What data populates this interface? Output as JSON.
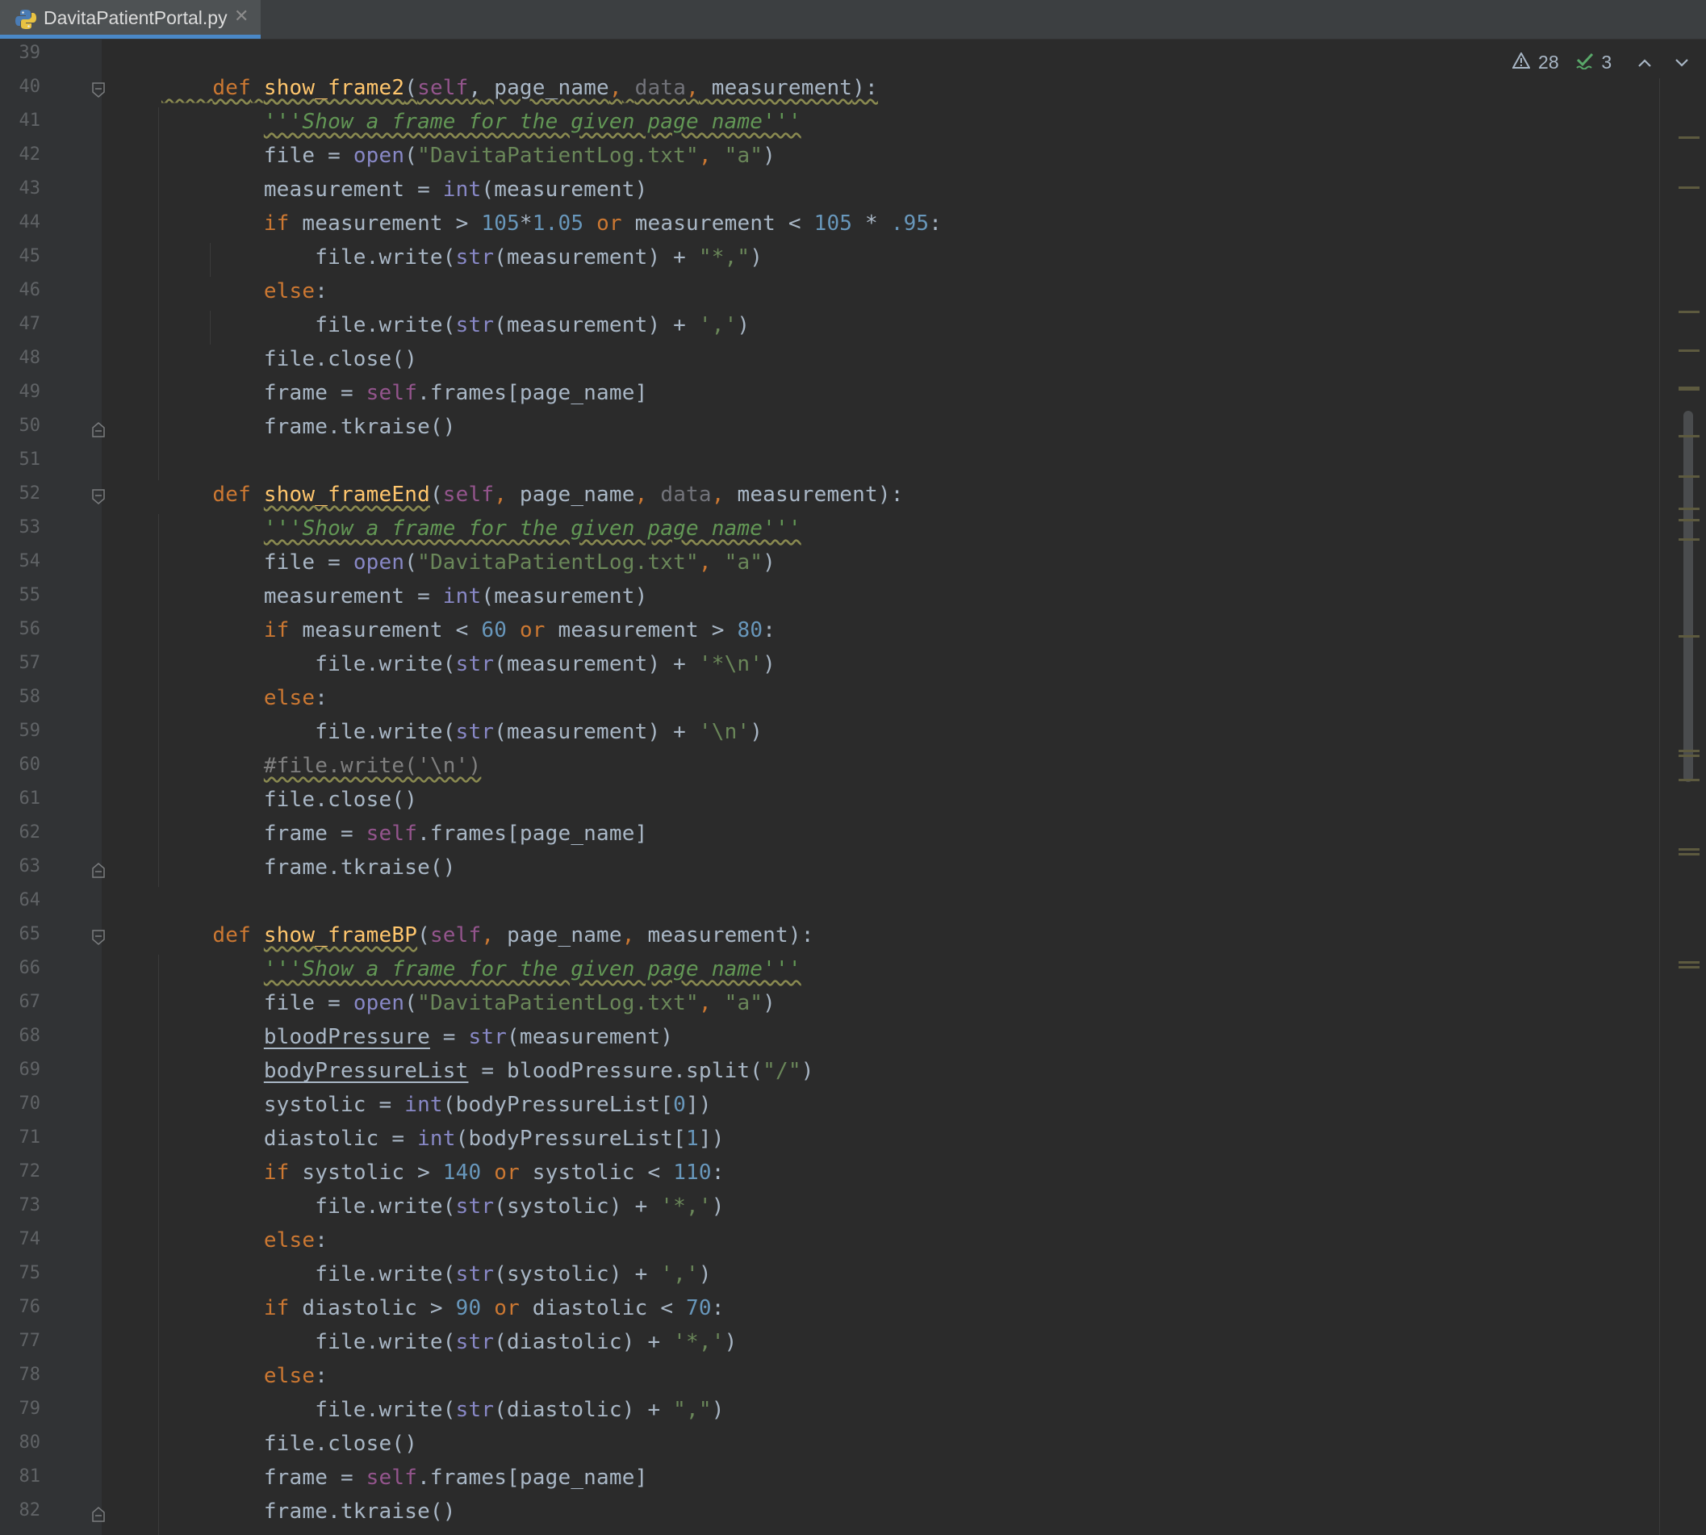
{
  "tab": {
    "filename": "DavitaPatientPortal.py",
    "icon": "python-file-icon",
    "close_icon": "close-icon"
  },
  "inspections": {
    "warnings": "28",
    "typos": "3"
  },
  "colors": {
    "background": "#2b2b2b",
    "keyword": "#cc7832",
    "function": "#ffc66d",
    "string": "#6a8759",
    "number": "#6897bb",
    "self": "#94558d",
    "builtin": "#8888c6",
    "docstring": "#629755"
  },
  "lines": [
    {
      "n": "39",
      "t": []
    },
    {
      "n": "40",
      "t": [
        [
          "    ",
          ""
        ],
        [
          "def",
          "kw"
        ],
        [
          " ",
          ""
        ],
        [
          "show_frame2",
          "fn"
        ],
        [
          "(",
          ""
        ],
        [
          "self",
          "sf"
        ],
        [
          ",",
          ""
        ],
        [
          " page_name",
          ""
        ],
        [
          ",",
          "kw"
        ],
        [
          " ",
          ""
        ],
        [
          "data",
          "gr"
        ],
        [
          ",",
          "kw"
        ],
        [
          " measurement",
          ""
        ],
        [
          "):",
          ""
        ]
      ],
      "wave": true,
      "fold": "open"
    },
    {
      "n": "41",
      "t": [
        [
          "        ",
          ""
        ],
        [
          "'''Show a frame for the given page name'''",
          "doc"
        ]
      ]
    },
    {
      "n": "42",
      "t": [
        [
          "        file = ",
          ""
        ],
        [
          "open",
          "bi"
        ],
        [
          "(",
          ""
        ],
        [
          "\"DavitaPatientLog.txt\"",
          "st"
        ],
        [
          ", ",
          "kw"
        ],
        [
          "\"a\"",
          "st"
        ],
        [
          ")",
          ""
        ]
      ]
    },
    {
      "n": "43",
      "t": [
        [
          "        measurement = ",
          ""
        ],
        [
          "int",
          "bi"
        ],
        [
          "(measurement)",
          ""
        ]
      ]
    },
    {
      "n": "44",
      "t": [
        [
          "        ",
          ""
        ],
        [
          "if",
          "kw"
        ],
        [
          " measurement > ",
          ""
        ],
        [
          "105",
          "nu"
        ],
        [
          "*",
          ""
        ],
        [
          "1.05",
          "nu"
        ],
        [
          " ",
          ""
        ],
        [
          "or",
          "kw"
        ],
        [
          " measurement < ",
          ""
        ],
        [
          "105",
          "nu"
        ],
        [
          " * ",
          ""
        ],
        [
          ".95",
          "nu"
        ],
        [
          ":",
          ""
        ]
      ]
    },
    {
      "n": "45",
      "t": [
        [
          "            file.write(",
          ""
        ],
        [
          "str",
          "bi"
        ],
        [
          "(measurement) + ",
          ""
        ],
        [
          "\"*,\"",
          "st"
        ],
        [
          ")",
          ""
        ]
      ]
    },
    {
      "n": "46",
      "t": [
        [
          "        ",
          ""
        ],
        [
          "else",
          "kw"
        ],
        [
          ":",
          ""
        ]
      ]
    },
    {
      "n": "47",
      "t": [
        [
          "            file.write(",
          ""
        ],
        [
          "str",
          "bi"
        ],
        [
          "(measurement) + ",
          ""
        ],
        [
          "','",
          "st"
        ],
        [
          ")",
          ""
        ]
      ]
    },
    {
      "n": "48",
      "t": [
        [
          "        file.close()",
          ""
        ]
      ]
    },
    {
      "n": "49",
      "t": [
        [
          "        frame = ",
          ""
        ],
        [
          "self",
          "sf"
        ],
        [
          ".frames[page_name]",
          ""
        ]
      ]
    },
    {
      "n": "50",
      "t": [
        [
          "        frame.tkraise()",
          ""
        ]
      ],
      "fold": "close"
    },
    {
      "n": "51",
      "t": []
    },
    {
      "n": "52",
      "t": [
        [
          "    ",
          ""
        ],
        [
          "def",
          "kw"
        ],
        [
          " ",
          ""
        ],
        [
          "show_frameEnd",
          "fn"
        ],
        [
          "(",
          ""
        ],
        [
          "self",
          "sf"
        ],
        [
          ",",
          "kw"
        ],
        [
          " page_name",
          ""
        ],
        [
          ",",
          "kw"
        ],
        [
          " ",
          ""
        ],
        [
          "data",
          "gr"
        ],
        [
          ",",
          "kw"
        ],
        [
          " measurement):",
          ""
        ]
      ],
      "fold": "open"
    },
    {
      "n": "53",
      "t": [
        [
          "        ",
          ""
        ],
        [
          "'''Show a frame for the given page name'''",
          "doc"
        ]
      ]
    },
    {
      "n": "54",
      "t": [
        [
          "        file = ",
          ""
        ],
        [
          "open",
          "bi"
        ],
        [
          "(",
          ""
        ],
        [
          "\"DavitaPatientLog.txt\"",
          "st"
        ],
        [
          ", ",
          "kw"
        ],
        [
          "\"a\"",
          "st"
        ],
        [
          ")",
          ""
        ]
      ]
    },
    {
      "n": "55",
      "t": [
        [
          "        measurement = ",
          ""
        ],
        [
          "int",
          "bi"
        ],
        [
          "(measurement)",
          ""
        ]
      ]
    },
    {
      "n": "56",
      "t": [
        [
          "        ",
          ""
        ],
        [
          "if",
          "kw"
        ],
        [
          " measurement < ",
          ""
        ],
        [
          "60",
          "nu"
        ],
        [
          " ",
          ""
        ],
        [
          "or",
          "kw"
        ],
        [
          " measurement > ",
          ""
        ],
        [
          "80",
          "nu"
        ],
        [
          ":",
          ""
        ]
      ]
    },
    {
      "n": "57",
      "t": [
        [
          "            file.write(",
          ""
        ],
        [
          "str",
          "bi"
        ],
        [
          "(measurement) + ",
          ""
        ],
        [
          "'*\\n'",
          "st"
        ],
        [
          ")",
          ""
        ]
      ]
    },
    {
      "n": "58",
      "t": [
        [
          "        ",
          ""
        ],
        [
          "else",
          "kw"
        ],
        [
          ":",
          ""
        ]
      ]
    },
    {
      "n": "59",
      "t": [
        [
          "            file.write(",
          ""
        ],
        [
          "str",
          "bi"
        ],
        [
          "(measurement) + ",
          ""
        ],
        [
          "'\\n'",
          "st"
        ],
        [
          ")",
          ""
        ]
      ]
    },
    {
      "n": "60",
      "t": [
        [
          "        ",
          ""
        ],
        [
          "#file.write('\\n')",
          "cm"
        ]
      ]
    },
    {
      "n": "61",
      "t": [
        [
          "        file.close()",
          ""
        ]
      ]
    },
    {
      "n": "62",
      "t": [
        [
          "        frame = ",
          ""
        ],
        [
          "self",
          "sf"
        ],
        [
          ".frames[page_name]",
          ""
        ]
      ]
    },
    {
      "n": "63",
      "t": [
        [
          "        frame.tkraise()",
          ""
        ]
      ],
      "fold": "close"
    },
    {
      "n": "64",
      "t": []
    },
    {
      "n": "65",
      "t": [
        [
          "    ",
          ""
        ],
        [
          "def",
          "kw"
        ],
        [
          " ",
          ""
        ],
        [
          "show_frameBP",
          "fn"
        ],
        [
          "(",
          ""
        ],
        [
          "self",
          "sf"
        ],
        [
          ",",
          "kw"
        ],
        [
          " page_name",
          ""
        ],
        [
          ",",
          "kw"
        ],
        [
          " measurement):",
          ""
        ]
      ],
      "fold": "open"
    },
    {
      "n": "66",
      "t": [
        [
          "        ",
          ""
        ],
        [
          "'''Show a frame for the given page name'''",
          "doc"
        ]
      ]
    },
    {
      "n": "67",
      "t": [
        [
          "        file = ",
          ""
        ],
        [
          "open",
          "bi"
        ],
        [
          "(",
          ""
        ],
        [
          "\"DavitaPatientLog.txt\"",
          "st"
        ],
        [
          ", ",
          "kw"
        ],
        [
          "\"a\"",
          "st"
        ],
        [
          ")",
          ""
        ]
      ]
    },
    {
      "n": "68",
      "t": [
        [
          "        ",
          ""
        ],
        [
          "bloodPressure",
          "ul"
        ],
        [
          " = ",
          ""
        ],
        [
          "str",
          "bi"
        ],
        [
          "(measurement)",
          ""
        ]
      ]
    },
    {
      "n": "69",
      "t": [
        [
          "        ",
          ""
        ],
        [
          "bodyPressureList",
          "ul"
        ],
        [
          " = bloodPressure.split(",
          ""
        ],
        [
          "\"/\"",
          "st"
        ],
        [
          ")",
          ""
        ]
      ]
    },
    {
      "n": "70",
      "t": [
        [
          "        systolic = ",
          ""
        ],
        [
          "int",
          "bi"
        ],
        [
          "(bodyPressureList[",
          ""
        ],
        [
          "0",
          "nu"
        ],
        [
          "])",
          ""
        ]
      ]
    },
    {
      "n": "71",
      "t": [
        [
          "        diastolic = ",
          ""
        ],
        [
          "int",
          "bi"
        ],
        [
          "(bodyPressureList[",
          ""
        ],
        [
          "1",
          "nu"
        ],
        [
          "])",
          ""
        ]
      ]
    },
    {
      "n": "72",
      "t": [
        [
          "        ",
          ""
        ],
        [
          "if",
          "kw"
        ],
        [
          " systolic > ",
          ""
        ],
        [
          "140",
          "nu"
        ],
        [
          " ",
          ""
        ],
        [
          "or",
          "kw"
        ],
        [
          " systolic < ",
          ""
        ],
        [
          "110",
          "nu"
        ],
        [
          ":",
          ""
        ]
      ]
    },
    {
      "n": "73",
      "t": [
        [
          "            file.write(",
          ""
        ],
        [
          "str",
          "bi"
        ],
        [
          "(systolic) + ",
          ""
        ],
        [
          "'*,'",
          "st"
        ],
        [
          ")",
          ""
        ]
      ]
    },
    {
      "n": "74",
      "t": [
        [
          "        ",
          ""
        ],
        [
          "else",
          "kw"
        ],
        [
          ":",
          ""
        ]
      ]
    },
    {
      "n": "75",
      "t": [
        [
          "            file.write(",
          ""
        ],
        [
          "str",
          "bi"
        ],
        [
          "(systolic) + ",
          ""
        ],
        [
          "','",
          "st"
        ],
        [
          ")",
          ""
        ]
      ]
    },
    {
      "n": "76",
      "t": [
        [
          "        ",
          ""
        ],
        [
          "if",
          "kw"
        ],
        [
          " diastolic > ",
          ""
        ],
        [
          "90",
          "nu"
        ],
        [
          " ",
          ""
        ],
        [
          "or",
          "kw"
        ],
        [
          " diastolic < ",
          ""
        ],
        [
          "70",
          "nu"
        ],
        [
          ":",
          ""
        ]
      ]
    },
    {
      "n": "77",
      "t": [
        [
          "            file.write(",
          ""
        ],
        [
          "str",
          "bi"
        ],
        [
          "(diastolic) + ",
          ""
        ],
        [
          "'*,'",
          "st"
        ],
        [
          ")",
          ""
        ]
      ]
    },
    {
      "n": "78",
      "t": [
        [
          "        ",
          ""
        ],
        [
          "else",
          "kw"
        ],
        [
          ":",
          ""
        ]
      ]
    },
    {
      "n": "79",
      "t": [
        [
          "            file.write(",
          ""
        ],
        [
          "str",
          "bi"
        ],
        [
          "(diastolic) + ",
          ""
        ],
        [
          "\",\"",
          "st"
        ],
        [
          ")",
          ""
        ]
      ]
    },
    {
      "n": "80",
      "t": [
        [
          "        file.close()",
          ""
        ]
      ]
    },
    {
      "n": "81",
      "t": [
        [
          "        frame = ",
          ""
        ],
        [
          "self",
          "sf"
        ],
        [
          ".frames[page_name]",
          ""
        ]
      ]
    },
    {
      "n": "82",
      "t": [
        [
          "        frame.tkraise()",
          ""
        ]
      ],
      "fold": "close"
    }
  ]
}
